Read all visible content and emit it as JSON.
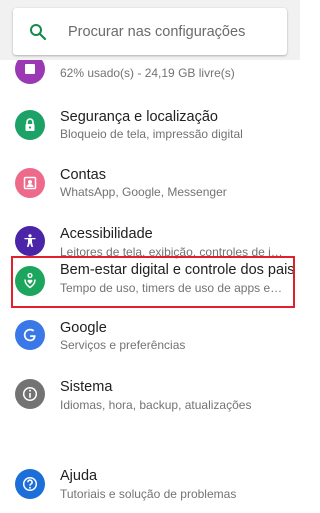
{
  "search": {
    "placeholder": "Procurar nas configurações",
    "icon": "search-icon",
    "icon_color": "#168a4e"
  },
  "items": [
    {
      "title": "",
      "subtitle": "62% usado(s) - 24,19 GB livre(s)",
      "icon": "storage-icon",
      "color": "#9b38b3"
    },
    {
      "title": "Segurança e localização",
      "subtitle": "Bloqueio de tela, impressão digital",
      "icon": "lock-icon",
      "color": "#1ca266"
    },
    {
      "title": "Contas",
      "subtitle": "WhatsApp, Google, Messenger",
      "icon": "account-icon",
      "color": "#ee6a8a"
    },
    {
      "title": "Acessibilidade",
      "subtitle": "Leitores de tela, exibição, controles de int...",
      "icon": "accessibility-icon",
      "color": "#4a25a8"
    },
    {
      "title": "Bem-estar digital e controle dos pais",
      "subtitle": "Tempo de uso, timers de uso de apps e h...",
      "icon": "wellbeing-icon",
      "color": "#1ca55c"
    },
    {
      "title": "Google",
      "subtitle": "Serviços e preferências",
      "icon": "google-icon",
      "color": "#3b78e7"
    },
    {
      "title": "Sistema",
      "subtitle": "Idiomas, hora, backup, atualizações",
      "icon": "info-icon",
      "color": "#737373"
    },
    {
      "title": "Ajuda",
      "subtitle": "Tutoriais e solução de problemas",
      "icon": "help-icon",
      "color": "#1c6fd9"
    }
  ],
  "highlight_color": "#e0212b"
}
